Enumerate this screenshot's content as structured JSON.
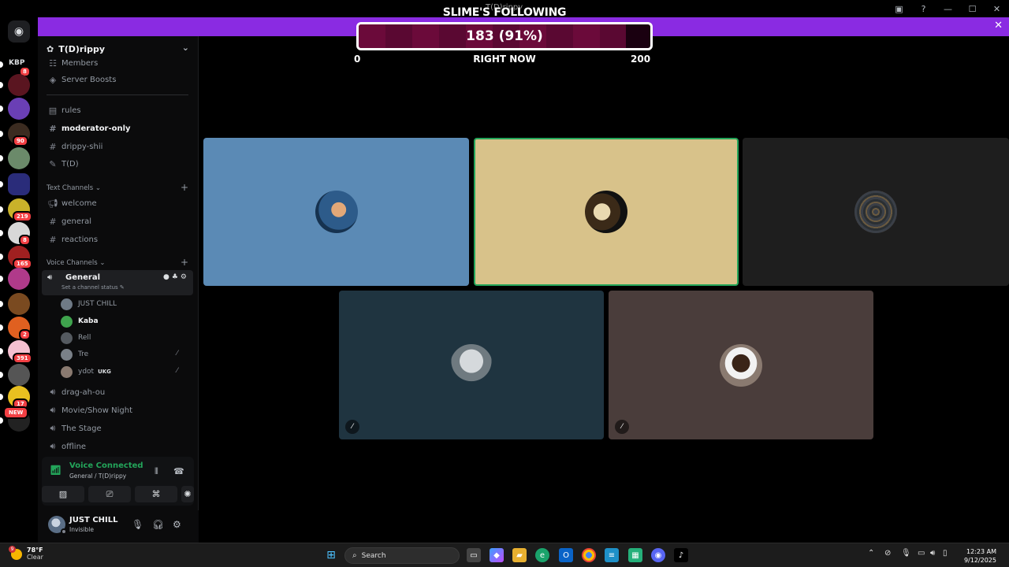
{
  "window": {
    "title": "T(D)rippy"
  },
  "overlay": {
    "title": "SLIME'S FOLLOWING",
    "count_text": "183 (91%)",
    "current": 183,
    "goal": 200,
    "fraction": 0.915,
    "min_label": "0",
    "mid_label": "RIGHT NOW",
    "max_label": "200"
  },
  "servers": [
    {
      "label": "KBP",
      "badge": "8"
    },
    {
      "badge": ""
    },
    {
      "badge": ""
    },
    {
      "badge": "90"
    },
    {
      "badge": ""
    },
    {
      "badge": ""
    },
    {
      "badge": "219"
    },
    {
      "badge": "8"
    },
    {
      "badge": "165"
    },
    {
      "badge": ""
    },
    {
      "badge": ""
    },
    {
      "badge": "2"
    },
    {
      "badge": "391"
    },
    {
      "badge": ""
    },
    {
      "badge": "17"
    },
    {
      "badge": "NEW"
    }
  ],
  "sidebar": {
    "server_name": "T(D)rippy",
    "top_items": [
      {
        "label": "Members",
        "icon": "members-icon"
      },
      {
        "label": "Server Boosts",
        "icon": "boost-icon"
      }
    ],
    "channels": [
      {
        "label": "rules",
        "icon": "rules-icon",
        "bold": false
      },
      {
        "label": "moderator-only",
        "icon": "hash-icon",
        "bold": true
      },
      {
        "label": "drippy-shii",
        "icon": "hash-icon",
        "bold": false
      },
      {
        "label": "T(D)",
        "icon": "forum-icon",
        "bold": false
      }
    ],
    "text_category": "Text Channels",
    "text_channels": [
      {
        "label": "welcome",
        "icon": "announcement-icon"
      },
      {
        "label": "general",
        "icon": "hash-icon"
      },
      {
        "label": "reactions",
        "icon": "hash-icon"
      }
    ],
    "voice_category": "Voice Channels",
    "active_voice": {
      "label": "General",
      "status": "Set a channel status"
    },
    "members": [
      {
        "name": "JUST CHILL",
        "bold": false,
        "muted": false,
        "tag": ""
      },
      {
        "name": "Kaba",
        "bold": true,
        "muted": false,
        "tag": ""
      },
      {
        "name": "Rell",
        "bold": false,
        "muted": false,
        "tag": ""
      },
      {
        "name": "Tre",
        "bold": false,
        "muted": true,
        "tag": ""
      },
      {
        "name": "ydot",
        "bold": false,
        "muted": true,
        "tag": "UKG"
      }
    ],
    "voice_channels": [
      {
        "label": "drag-ah-ou"
      },
      {
        "label": "Movie/Show Night"
      },
      {
        "label": "The Stage"
      },
      {
        "label": "offline"
      }
    ]
  },
  "voice_panel": {
    "title": "Voice Connected",
    "subtitle": "General / T(D)rippy"
  },
  "user": {
    "name": "JUST CHILL",
    "status": "Invisible"
  },
  "tiles": [
    {
      "name": "tile-user-1",
      "bg": "#5b8ab5",
      "border": "none",
      "muted": false
    },
    {
      "name": "tile-user-2",
      "bg": "#d8c28a",
      "border": "#23a55a",
      "muted": false
    },
    {
      "name": "tile-user-3",
      "bg": "#1e1e1e",
      "border": "none",
      "muted": false
    },
    {
      "name": "tile-user-4",
      "bg": "#1f3440",
      "border": "none",
      "muted": true
    },
    {
      "name": "tile-user-5",
      "bg": "#4a3d3b",
      "border": "none",
      "muted": true
    }
  ],
  "taskbar": {
    "weather_temp": "78°F",
    "weather_cond": "Clear",
    "weather_badge": "9",
    "search_placeholder": "Search",
    "time": "12:23 AM",
    "date": "9/12/2025"
  },
  "colors": {
    "banner": "#8a2be2",
    "voice_green": "#23a55a",
    "badge_red": "#f23f43"
  }
}
